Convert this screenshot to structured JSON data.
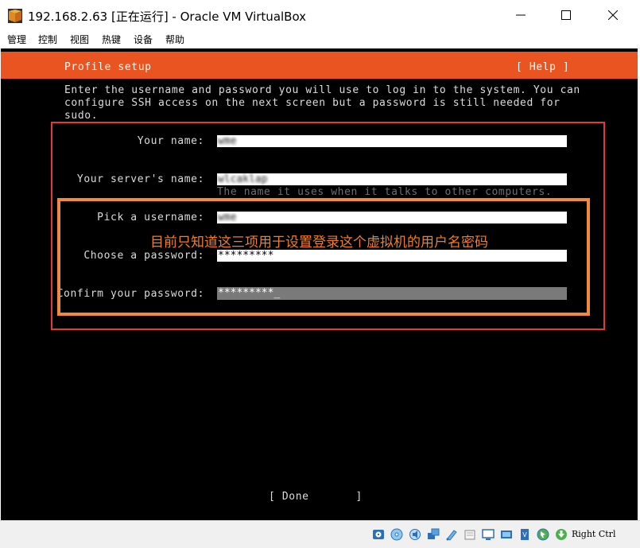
{
  "window": {
    "title": "192.168.2.63 [正在运行] - Oracle VM VirtualBox",
    "minimize_icon": "minimize-icon",
    "maximize_icon": "maximize-icon",
    "close_icon": "close-icon"
  },
  "menu": [
    "管理",
    "控制",
    "视图",
    "热键",
    "设备",
    "帮助"
  ],
  "installer": {
    "header_title": "Profile setup",
    "help_label": "[ Help ]",
    "intro": "Enter the username and password you will use to log in to the system. You can\nconfigure SSH access on the next screen but a password is still needed for\nsudo.",
    "form": {
      "your_name_label": "Your name:",
      "your_name_value": "wme",
      "server_name_label": "Your server's name:",
      "server_name_value": "wlcaklap",
      "server_name_hint": "The name it uses when it talks to other computers.",
      "username_label": "Pick a username:",
      "username_value": "wme",
      "password_label": "Choose a password:",
      "password_value": "*********",
      "confirm_label": "Confirm your password:",
      "confirm_value": "*********_"
    },
    "done_label": "[ Done       ]"
  },
  "annotation": {
    "text": "目前只知道这三项用于设置登录这个虚拟机的用户名密码",
    "color": "#f07e2b",
    "outer_box_color": "#e2393a",
    "inner_box_color": "#f08a3c"
  },
  "colors": {
    "accent": "#e95420",
    "vm_background": "#000000"
  },
  "statusbar": {
    "icons": [
      "hard-disk-icon",
      "optical-drive-icon",
      "audio-icon",
      "network-icon",
      "usb-icon",
      "shared-folder-icon",
      "display-icon",
      "recording-icon",
      "cpu-icon",
      "mouse-integration-icon",
      "keyboard-capture-icon"
    ],
    "host_key": "Right Ctrl"
  }
}
